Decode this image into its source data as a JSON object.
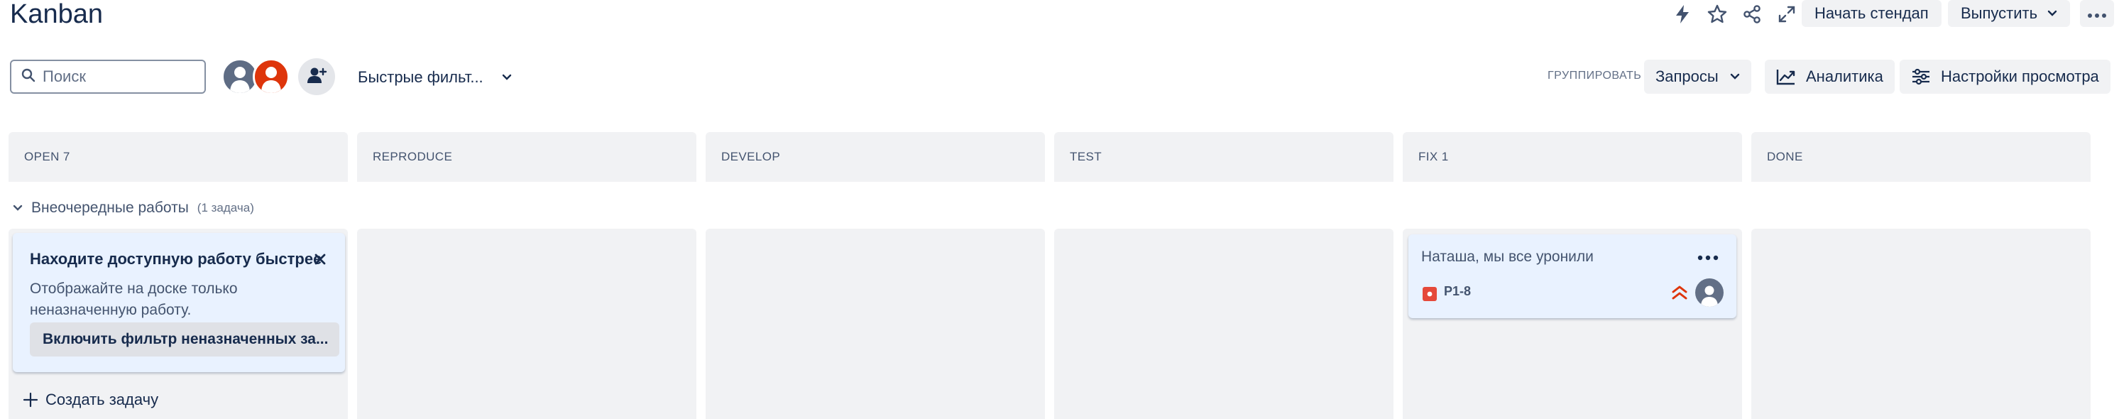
{
  "header": {
    "title": "Kanban",
    "icons": [
      "lightning-icon",
      "star-icon",
      "share-icon",
      "expand-icon"
    ],
    "start_standup": "Начать стендап",
    "release": "Выпустить",
    "more_icon": "more-icon"
  },
  "toolbar": {
    "search_placeholder": "Поиск",
    "quick_filters": "Быстрые фильт...",
    "group_by_label": "ГРУППИРОВАТЬ",
    "group_by_value": "Запросы",
    "analytics": "Аналитика",
    "view_settings": "Настройки просмотра"
  },
  "columns": [
    {
      "title": "OPEN 7"
    },
    {
      "title": "REPRODUCE"
    },
    {
      "title": "DEVELOP"
    },
    {
      "title": "TEST"
    },
    {
      "title": "FIX 1"
    },
    {
      "title": "DONE"
    }
  ],
  "swimlane": {
    "title": "Внеочередные работы",
    "count": "(1 задача)"
  },
  "tip_card": {
    "title": "Находите доступную работу быстрее",
    "text": "Отображайте на доске только неназначенную работу.",
    "button": "Включить фильтр неназначенных за..."
  },
  "create_task": "Создать задачу",
  "issue": {
    "summary": "Наташа, мы все уронили",
    "key": "P1-8",
    "type": "bug",
    "priority": "high"
  },
  "colors": {
    "text": "#172b4d",
    "column_bg": "#f1f2f4",
    "card_bg": "#e9f2ff",
    "bug": "#e5493a",
    "priority": "#de350b",
    "avatar_red": "#de350b",
    "avatar_grey": "#5e6c84"
  }
}
